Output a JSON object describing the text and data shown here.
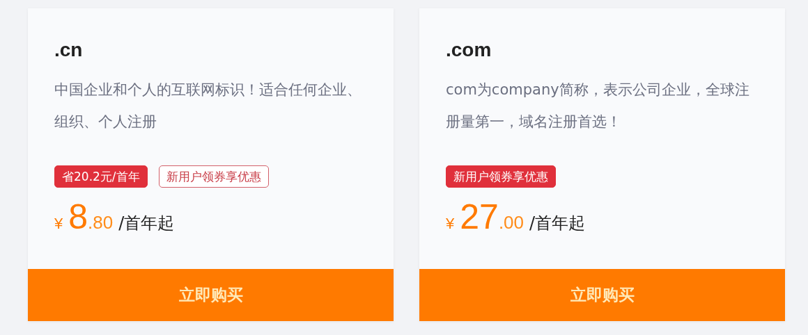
{
  "products": [
    {
      "title": ".cn",
      "description": "中国企业和个人的互联网标识！适合任何企业、组织、个人注册",
      "tags": [
        {
          "label": "省20.2元/首年",
          "kind": "filled"
        },
        {
          "label": "新用户领券享优惠",
          "kind": "outline"
        }
      ],
      "currency": "¥",
      "price_integer": "8",
      "price_decimal": ".80",
      "price_unit": "/首年起",
      "button": "立即购买"
    },
    {
      "title": ".com",
      "description": "com为company简称，表示公司企业，全球注册量第一，域名注册首选！",
      "tags": [
        {
          "label": "新用户领券享优惠",
          "kind": "filled"
        }
      ],
      "currency": "¥",
      "price_integer": "27",
      "price_decimal": ".00",
      "price_unit": "/首年起",
      "button": "立即购买"
    }
  ]
}
